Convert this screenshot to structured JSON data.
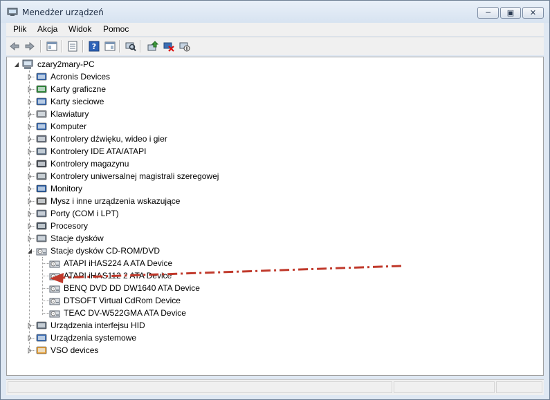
{
  "window": {
    "title": "Menedżer urządzeń",
    "controls": [
      "minimize",
      "maximize",
      "close"
    ]
  },
  "menu": {
    "items": [
      "Plik",
      "Akcja",
      "Widok",
      "Pomoc"
    ]
  },
  "toolbar": {
    "buttons": [
      "back-icon",
      "forward-icon",
      "show-hide-console-tree-icon",
      "properties-icon",
      "help-icon",
      "action-pane-icon",
      "scan-hardware-icon",
      "update-driver-icon",
      "uninstall-icon",
      "disable-icon"
    ]
  },
  "tree": {
    "root": "czary2mary-PC",
    "categories": [
      {
        "label": "Acronis Devices",
        "icon": "network-device-icon"
      },
      {
        "label": "Karty graficzne",
        "icon": "display-adapter-icon"
      },
      {
        "label": "Karty sieciowe",
        "icon": "network-adapter-icon"
      },
      {
        "label": "Klawiatury",
        "icon": "keyboard-icon"
      },
      {
        "label": "Komputer",
        "icon": "computer-icon"
      },
      {
        "label": "Kontrolery dźwięku, wideo i gier",
        "icon": "speaker-icon"
      },
      {
        "label": "Kontrolery IDE ATA/ATAPI",
        "icon": "ide-controller-icon"
      },
      {
        "label": "Kontrolery magazynu",
        "icon": "storage-controller-icon"
      },
      {
        "label": "Kontrolery uniwersalnej magistrali szeregowej",
        "icon": "usb-icon"
      },
      {
        "label": "Monitory",
        "icon": "monitor-icon"
      },
      {
        "label": "Mysz i inne urządzenia wskazujące",
        "icon": "mouse-icon"
      },
      {
        "label": "Porty (COM i LPT)",
        "icon": "port-icon"
      },
      {
        "label": "Procesory",
        "icon": "processor-icon"
      },
      {
        "label": "Stacje dysków",
        "icon": "disk-drive-icon"
      },
      {
        "label": "Stacje dysków CD-ROM/DVD",
        "icon": "cdrom-drive-icon",
        "expanded": true,
        "children": [
          "ATAPI iHAS224   A ATA Device",
          "ATAPI iHAS112   2 ATA Device",
          "BENQ DVD DD DW1640 ATA Device",
          "DTSOFT Virtual CdRom Device",
          "TEAC DV-W522GMA ATA Device"
        ]
      },
      {
        "label": "Urządzenia interfejsu HID",
        "icon": "hid-icon"
      },
      {
        "label": "Urządzenia systemowe",
        "icon": "system-device-icon"
      },
      {
        "label": "VSO devices",
        "icon": "vso-icon"
      }
    ]
  },
  "annotation": {
    "color": "#c0392b",
    "points_to": "ATAPI iHAS112   2 ATA Device"
  }
}
